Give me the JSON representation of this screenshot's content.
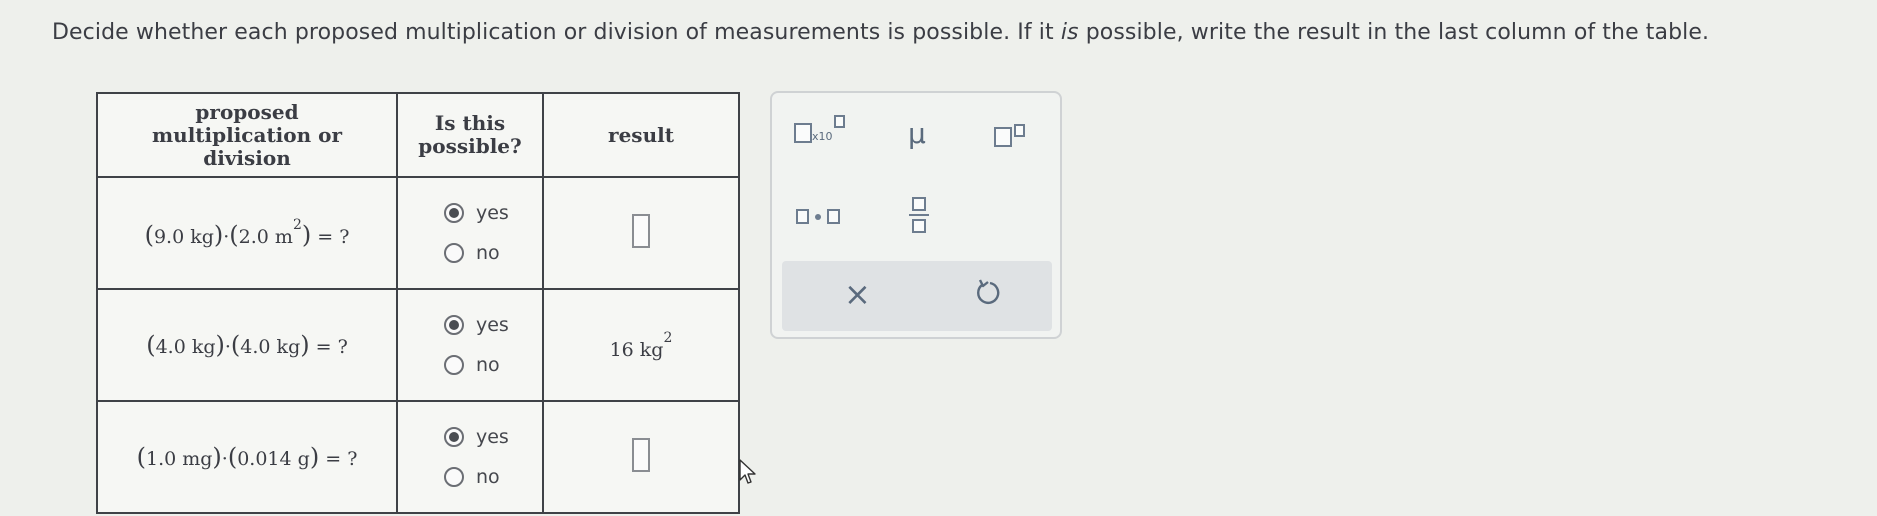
{
  "instructions": {
    "part1": "Decide whether each proposed multiplication or division of measurements is possible. If it ",
    "emph": "is",
    "part2": " possible, write the result in the last column of the table."
  },
  "table": {
    "headers": {
      "col1": [
        "proposed",
        "multiplication or division"
      ],
      "col2": [
        "Is this",
        "possible?"
      ],
      "col3": "result"
    },
    "rows": [
      {
        "q1": "9.0 kg",
        "q2": "2.0 m",
        "q2_exp": "2",
        "tail": " = ?",
        "yes_label": "yes",
        "no_label": "no",
        "selected": "yes",
        "result": "",
        "result_exp": ""
      },
      {
        "q1": "4.0 kg",
        "q2": "4.0 kg",
        "q2_exp": "",
        "tail": " = ?",
        "yes_label": "yes",
        "no_label": "no",
        "selected": "yes",
        "result": "16 kg",
        "result_exp": "2"
      },
      {
        "q1": "1.0 mg",
        "q2": "0.014 g",
        "q2_exp": "",
        "tail": " = ?",
        "yes_label": "yes",
        "no_label": "no",
        "selected": "yes",
        "result": "",
        "result_exp": ""
      }
    ]
  },
  "palette": {
    "times10_label": "x10",
    "mu_symbol": "μ"
  },
  "icons": {
    "sci_notation": "x10-box-icon",
    "mu": "mu-icon",
    "exponent": "exponent-box-icon",
    "multiply": "multiply-dot-icon",
    "fraction": "fraction-icon",
    "clear": "x-icon",
    "undo": "undo-icon"
  }
}
